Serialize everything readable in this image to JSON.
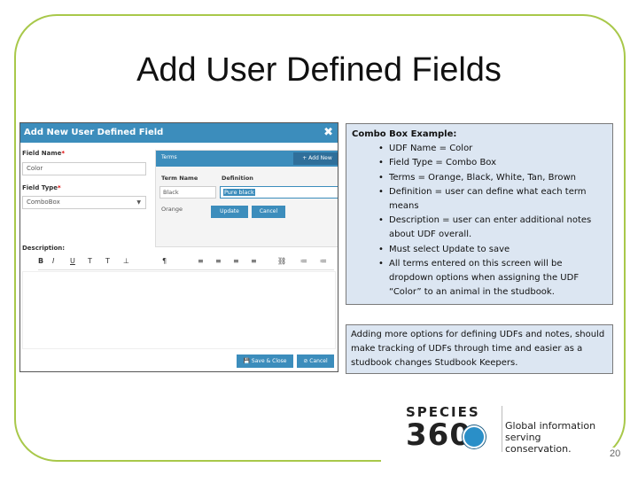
{
  "slide": {
    "title": "Add User Defined Fields",
    "page_number": "20"
  },
  "dialog": {
    "title": "Add New User Defined Field",
    "field_name_label": "Field Name",
    "field_name_value": "Color",
    "field_type_label": "Field Type",
    "field_type_value": "ComboBox",
    "terms_label": "Terms",
    "add_new_label": "Add New",
    "term_name_header": "Term Name",
    "definition_header": "Definition",
    "term_row1_name": "Black",
    "term_row1_definition": "Pure black",
    "term_row2_name": "Orange",
    "update_label": "Update",
    "cancel_term_label": "Cancel",
    "description_label": "Description",
    "save_close_label": "Save & Close",
    "cancel_label": "Cancel",
    "toolbar": [
      "B",
      "I",
      "U",
      "T",
      "T",
      "⊥",
      "¶",
      "≡",
      "≡",
      "≡",
      "≡",
      "⛓",
      "≔",
      "≔"
    ]
  },
  "note1": {
    "title": "Combo Box Example:",
    "bullets": [
      "UDF Name = Color",
      "Field Type = Combo Box",
      "Terms = Orange, Black, White, Tan, Brown",
      "Definition = user can define what each term means",
      "Description = user can enter additional notes about UDF overall.",
      "Must select Update to save",
      "All terms entered on this screen will be dropdown options when assigning the UDF “Color” to an animal in the studbook."
    ]
  },
  "note2": {
    "text": "Adding more options for defining UDFs and notes, should make tracking of UDFs through time and easier as a studbook changes Studbook Keepers."
  },
  "logo": {
    "word": "SPECIES",
    "number": "360",
    "tagline_line1": "Global information",
    "tagline_line2": "serving conservation."
  },
  "colors": {
    "frame": "#a8c84a",
    "dialog_header": "#3c8dbc",
    "note_bg": "#dce6f2"
  }
}
